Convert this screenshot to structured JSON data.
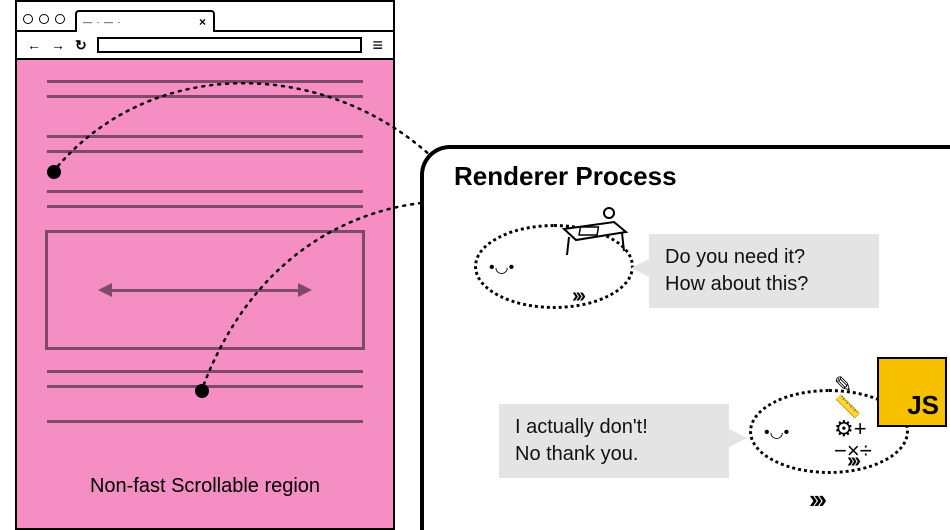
{
  "browser": {
    "tab_text": "— · — ·",
    "tab_close": "×",
    "nav_back_glyph": "←",
    "nav_fwd_glyph": "→",
    "nav_reload_glyph": "↻",
    "menu_glyph": "≡",
    "region_label": "Non-fast Scrollable region"
  },
  "renderer": {
    "title": "Renderer Process",
    "js_label": "JS",
    "bubble_top_line1": "Do you need it?",
    "bubble_top_line2": "How about this?",
    "bubble_bot_line1": "I actually don't!",
    "bubble_bot_line2": "No thank you.",
    "face_glyph": "•◡•",
    "chevrons_glyph": "›››",
    "trail_chevrons_glyph": "›››"
  }
}
